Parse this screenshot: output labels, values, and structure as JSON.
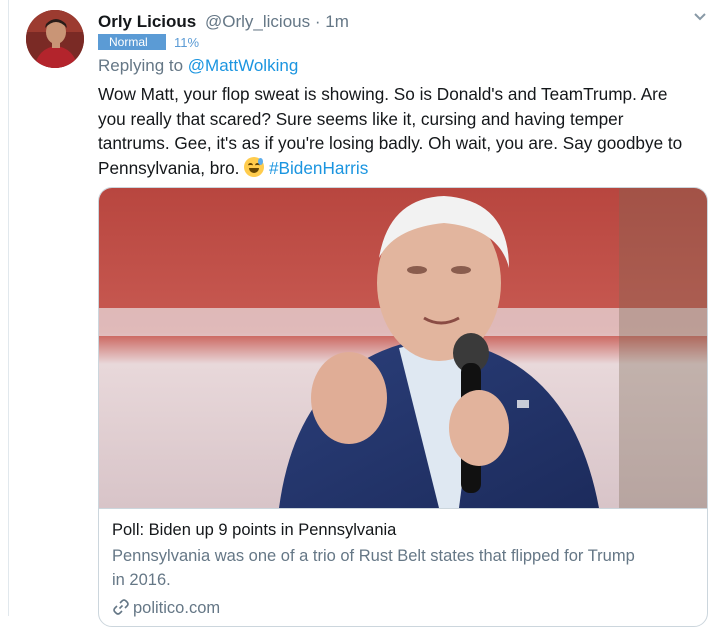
{
  "tweet": {
    "display_name": "Orly Licious",
    "handle": "@Orly_licious",
    "separator": "·",
    "time": "1m",
    "badge_label": "Normal",
    "badge_percent": "11%",
    "replying_prefix": "Replying to",
    "replying_handle": "@MattWolking",
    "text_lines": [
      "Wow Matt, your flop sweat is showing. So is Donald's and TeamTrump. Are",
      "you really that scared? Sure seems like it, cursing and having temper",
      "tantrums. Gee, it's as if you're losing badly. Oh wait, you are. Say goodbye to",
      "Pennsylvania, bro."
    ],
    "emoji": "sweat-smile-emoji",
    "hashtag": "#BidenHarris"
  },
  "card": {
    "title": "Poll: Biden up 9 points in Pennsylvania",
    "description_lines": [
      "Pennsylvania was one of a trio of Rust Belt states that flipped for Trump",
      "in 2016."
    ],
    "domain": "politico.com",
    "image": "photo-of-speaker-with-microphone"
  },
  "icons": {
    "caret": "chevron-down-icon",
    "link": "link-icon"
  },
  "colors": {
    "link": "#1b95e0",
    "secondary_text": "#657786",
    "badge": "#5b9bd5"
  }
}
